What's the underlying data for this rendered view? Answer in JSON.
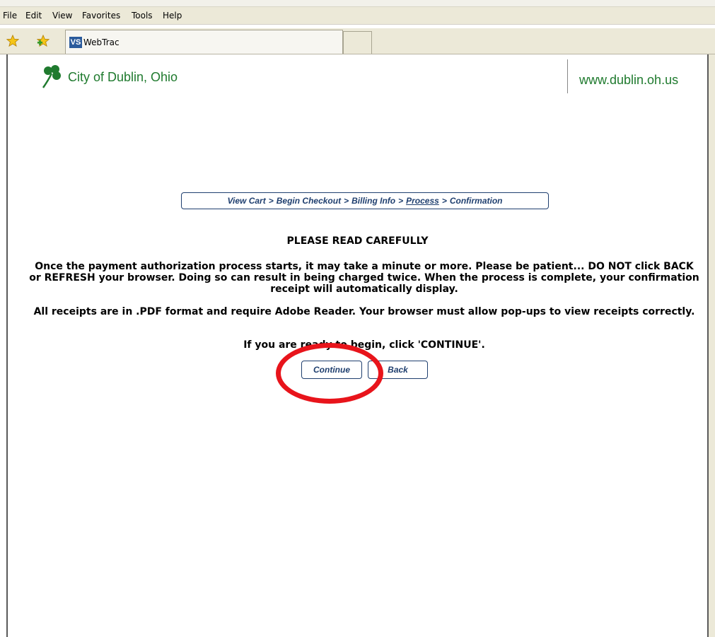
{
  "menu": {
    "items": [
      "File",
      "Edit",
      "View",
      "Favorites",
      "Tools",
      "Help"
    ]
  },
  "tab": {
    "title": "WebTrac",
    "icon": "webtrac-logo-icon"
  },
  "site": {
    "logo_icon": "shamrock-icon",
    "name": "City of Dublin, Ohio",
    "url": "www.dublin.oh.us",
    "brand_color": "#1f7a2e"
  },
  "breadcrumb": {
    "steps": [
      "View Cart",
      "Begin Checkout",
      "Billing Info",
      "Process",
      "Confirmation"
    ],
    "separator": ">",
    "current_index": 3
  },
  "notice": {
    "heading": "PLEASE READ CAREFULLY",
    "paragraph1": "Once the payment authorization process starts, it may take a minute or more. Please be patient... DO NOT click BACK or REFRESH your browser. Doing so can result in being charged twice. When the process is complete, your confirmation receipt will automatically display.",
    "paragraph2": "All receipts are in .PDF format and require Adobe Reader. Your browser must allow pop-ups to view receipts correctly.",
    "paragraph3": "If you are ready to begin, click 'CONTINUE'."
  },
  "buttons": {
    "continue_label": "Continue",
    "back_label": "Back"
  },
  "annotation": {
    "color": "#e8141b"
  }
}
